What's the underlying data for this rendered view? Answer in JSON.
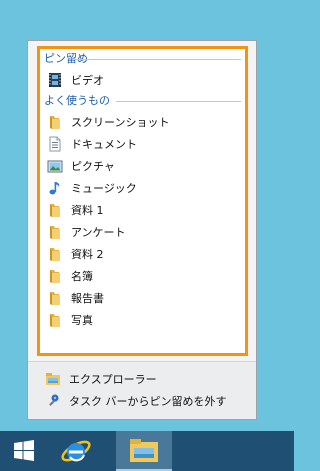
{
  "jumplist": {
    "pinned_header": "ピン留め",
    "pinned_items": [
      {
        "label": "ビデオ",
        "icon": "video-icon"
      }
    ],
    "frequent_header": "よく使うもの",
    "frequent_items": [
      {
        "label": "スクリーンショット",
        "icon": "folder-icon"
      },
      {
        "label": "ドキュメント",
        "icon": "document-icon"
      },
      {
        "label": "ピクチャ",
        "icon": "picture-icon"
      },
      {
        "label": "ミュージック",
        "icon": "music-icon"
      },
      {
        "label": "資料 1",
        "icon": "folder-icon"
      },
      {
        "label": "アンケート",
        "icon": "folder-icon"
      },
      {
        "label": "資料 2",
        "icon": "folder-icon"
      },
      {
        "label": "名簿",
        "icon": "folder-icon"
      },
      {
        "label": "報告書",
        "icon": "folder-icon"
      },
      {
        "label": "写真",
        "icon": "folder-icon"
      }
    ],
    "actions": [
      {
        "label": "エクスプローラー",
        "icon": "explorer-icon"
      },
      {
        "label": "タスク バーからピン留めを外す",
        "icon": "unpin-icon"
      }
    ]
  },
  "taskbar": {
    "buttons": [
      {
        "name": "start",
        "icon": "windows-logo-icon"
      },
      {
        "name": "internet-explorer",
        "icon": "internet-explorer-icon"
      },
      {
        "name": "file-explorer",
        "icon": "file-explorer-icon",
        "active": true
      }
    ]
  },
  "colors": {
    "desktop": "#6cc3dd",
    "highlight_border": "#f29313",
    "header_text": "#1f5fa8",
    "taskbar": "#1f4f73"
  }
}
